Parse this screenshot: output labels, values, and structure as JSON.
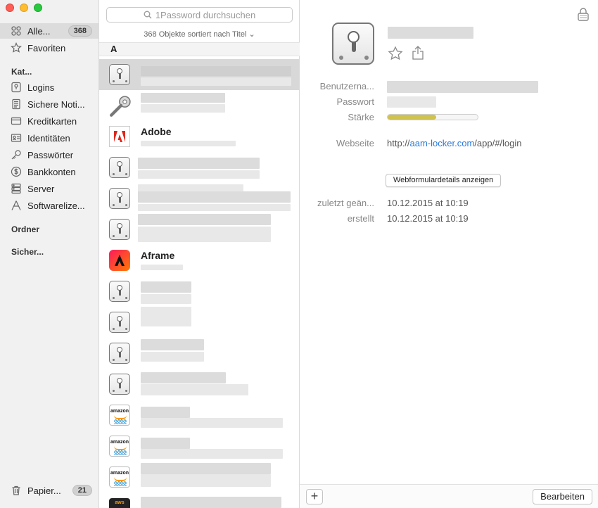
{
  "sidebar": {
    "all": {
      "label": "Alle...",
      "count": "368"
    },
    "favorites": {
      "label": "Favoriten"
    },
    "categories_header": "Kat...",
    "categories": [
      {
        "label": "Logins",
        "icon": "login-icon"
      },
      {
        "label": "Sichere Noti...",
        "icon": "note-icon"
      },
      {
        "label": "Kreditkarten",
        "icon": "credit-card-icon"
      },
      {
        "label": "Identitäten",
        "icon": "identity-icon"
      },
      {
        "label": "Passwörter",
        "icon": "key-icon"
      },
      {
        "label": "Bankkonten",
        "icon": "bank-icon"
      },
      {
        "label": "Server",
        "icon": "server-icon"
      },
      {
        "label": "Softwarelize...",
        "icon": "software-icon"
      }
    ],
    "folders_header": "Ordner",
    "security_header": "Sicher...",
    "trash": {
      "label": "Papier...",
      "count": "21"
    }
  },
  "list": {
    "search_placeholder": "1Password durchsuchen",
    "sort_label": "368 Objekte sortiert nach Titel",
    "section_letter": "A",
    "items": [
      {
        "icon": "lock-icon",
        "title": ""
      },
      {
        "icon": "key-icon",
        "title": ""
      },
      {
        "icon": "adobe-logo",
        "title": "Adobe"
      },
      {
        "icon": "lock-icon",
        "title": ""
      },
      {
        "icon": "lock-icon",
        "title": ""
      },
      {
        "icon": "lock-icon",
        "title": ""
      },
      {
        "icon": "aframe-logo",
        "title": "Aframe"
      },
      {
        "icon": "lock-icon",
        "title": ""
      },
      {
        "icon": "lock-icon",
        "title": ""
      },
      {
        "icon": "lock-icon",
        "title": ""
      },
      {
        "icon": "lock-icon",
        "title": ""
      },
      {
        "icon": "amazon-logo",
        "title": "",
        "logo_text": "amazon"
      },
      {
        "icon": "amazon-logo",
        "title": "",
        "logo_text": "amazon"
      },
      {
        "icon": "amazon-logo",
        "title": "",
        "logo_text": "amazon"
      },
      {
        "icon": "aws-logo",
        "title": "",
        "logo_text": "aws"
      }
    ]
  },
  "detail": {
    "fields": {
      "username_label": "Benutzerna...",
      "password_label": "Passwort",
      "strength_label": "Stärke",
      "strength_value": 0.54,
      "website_label": "Webseite",
      "website_prefix": "http://",
      "website_domain": "aam-locker.com",
      "website_path": "/app/#/login",
      "webform_button": "Webformulardetails anzeigen",
      "modified_label": "zuletzt geän...",
      "modified_value": "10.12.2015 at 10:19",
      "created_label": "erstellt",
      "created_value": "10.12.2015 at 10:19"
    },
    "add_button": "+",
    "edit_button": "Bearbeiten"
  },
  "colors": {
    "accent_link": "#2a7ad6",
    "strength_fill": "#cfc24d",
    "selected_row": "#d8d8d8"
  }
}
